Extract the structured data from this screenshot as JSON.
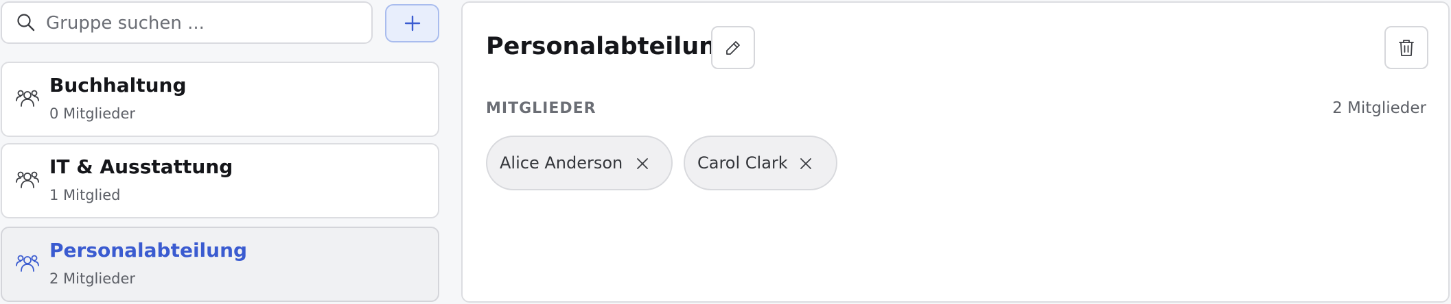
{
  "search": {
    "placeholder": "Gruppe suchen ..."
  },
  "add_button": {
    "icon": "plus-icon"
  },
  "groups": [
    {
      "name": "Buchhaltung",
      "count": "0 Mitglieder",
      "icon": "users-icon"
    },
    {
      "name": "IT & Ausstattung",
      "count": "1 Mitglied",
      "icon": "users-icon"
    },
    {
      "name": "Personalabteilung",
      "count": "2 Mitglieder",
      "icon": "users-icon",
      "selected": true
    }
  ],
  "detail": {
    "title": "Personalabteilung",
    "members_label": "MITGLIEDER",
    "members_count": "2 Mitglieder",
    "members": [
      {
        "name": "Alice Anderson"
      },
      {
        "name": "Carol Clark"
      }
    ]
  },
  "colors": {
    "accent": "#3a5bd0",
    "accent_bg": "#e8eefc",
    "page_bg": "#f6f7f9"
  }
}
